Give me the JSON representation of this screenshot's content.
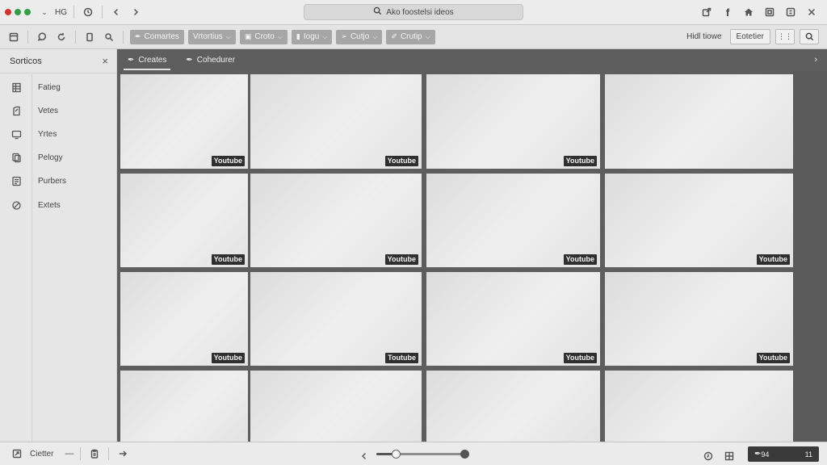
{
  "topbar": {
    "dot_colors": [
      "#d9302a",
      "#2fa043",
      "#2fa043"
    ],
    "app_code": "HG",
    "address": "Ako foostelsi ideos",
    "right_icons": [
      "share-icon",
      "facebook-icon",
      "home-icon",
      "window-icon",
      "settings-icon",
      "close-icon"
    ]
  },
  "toolbar": {
    "buttons": [
      {
        "label": "Comartes",
        "icon": "pen-icon"
      },
      {
        "label": "Vrtortius",
        "icon": ""
      },
      {
        "label": "Croto",
        "icon": "folder-icon"
      },
      {
        "label": "Iogu",
        "icon": "doc-icon"
      },
      {
        "label": "Cutjo",
        "icon": "tag-icon"
      },
      {
        "label": "Crutip",
        "icon": "brush-icon"
      }
    ],
    "status_text": "Hidl tiowe",
    "filter_label": "Eotetier",
    "pin_label": "i"
  },
  "sidebar": {
    "title": "Sorticos",
    "items": [
      {
        "label": "Fatieg",
        "icon": "grid-doc-icon"
      },
      {
        "label": "Vetes",
        "icon": "edit-doc-icon"
      },
      {
        "label": "Yrtes",
        "icon": "monitor-icon"
      },
      {
        "label": "Pelogy",
        "icon": "copy-icon"
      },
      {
        "label": "Purbers",
        "icon": "list-doc-icon"
      },
      {
        "label": "Extets",
        "icon": "gear-icon"
      }
    ]
  },
  "content_tabs": [
    {
      "label": "Creates",
      "active": true
    },
    {
      "label": "Cohedurer",
      "active": false
    }
  ],
  "grid": {
    "badge_text": "Youtube",
    "tiles": [
      {
        "badge": "Youtube"
      },
      {
        "badge": "Youtube"
      },
      {
        "badge": "Youtube"
      },
      {
        "badge": ""
      },
      {
        "badge": "Youtube"
      },
      {
        "badge": "Youtube"
      },
      {
        "badge": "Youtube"
      },
      {
        "badge": "Youtube"
      },
      {
        "badge": "Youtube"
      },
      {
        "badge": "Toutube"
      },
      {
        "badge": "Youtube"
      },
      {
        "badge": "Youtube"
      },
      {
        "badge": ""
      },
      {
        "badge": ""
      },
      {
        "badge": ""
      },
      {
        "badge": ""
      }
    ]
  },
  "bottombar": {
    "status_label": "Cietter",
    "slider_value": 0.22,
    "counter_left": "94",
    "counter_right": "11"
  },
  "colors": {
    "chrome": "#ececec",
    "content_bg": "#5e5e5e",
    "button_bg": "#a6a6a6",
    "badge_bg": "#2f2f2f"
  }
}
